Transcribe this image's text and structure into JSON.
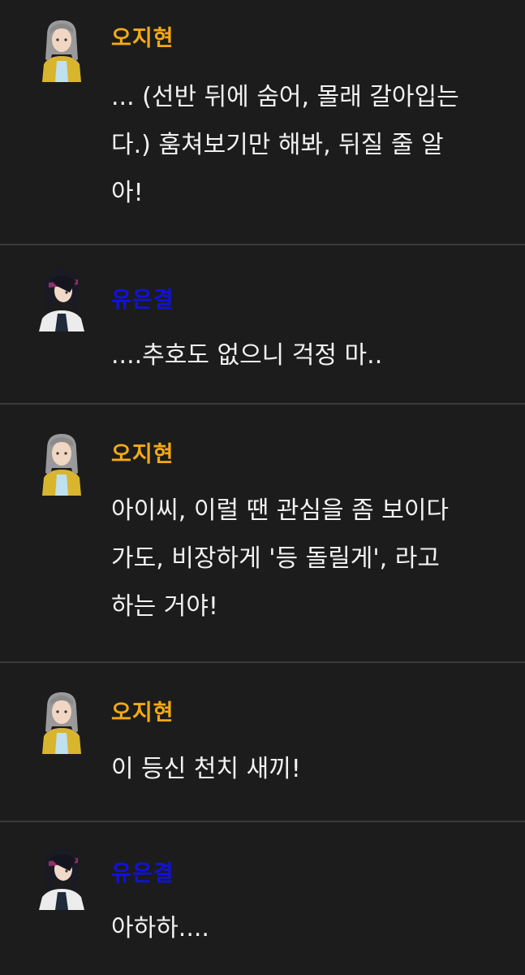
{
  "colors": {
    "background": "#1c1c1c",
    "divider": "#3a3a3a",
    "ojh_name": "#f3aa14",
    "yeg_name": "#1111dd",
    "text": "#f2f2f2"
  },
  "messages": [
    {
      "speaker": "오지현",
      "avatar_icon": "grey-haired-character-avatar-icon",
      "lines": [
        "... (선반 뒤에 숨어, 몰래 갈아입는",
        "다.) 훔쳐보기만 해봐, 뒤질 줄 알",
        "아!"
      ]
    },
    {
      "speaker": "유은결",
      "avatar_icon": "dark-haired-character-avatar-icon",
      "lines": [
        "....추호도 없으니 걱정 마.."
      ]
    },
    {
      "speaker": "오지현",
      "avatar_icon": "grey-haired-character-avatar-icon",
      "lines": [
        "아이씨, 이럴 땐 관심을 좀 보이다",
        "가도, 비장하게 '등 돌릴게', 라고",
        "하는 거야!"
      ]
    },
    {
      "speaker": "오지현",
      "avatar_icon": "grey-haired-character-avatar-icon",
      "lines": [
        "이 등신 천치 새끼!"
      ]
    },
    {
      "speaker": "유은결",
      "avatar_icon": "dark-haired-character-avatar-icon",
      "lines": [
        "아하하...."
      ]
    }
  ]
}
